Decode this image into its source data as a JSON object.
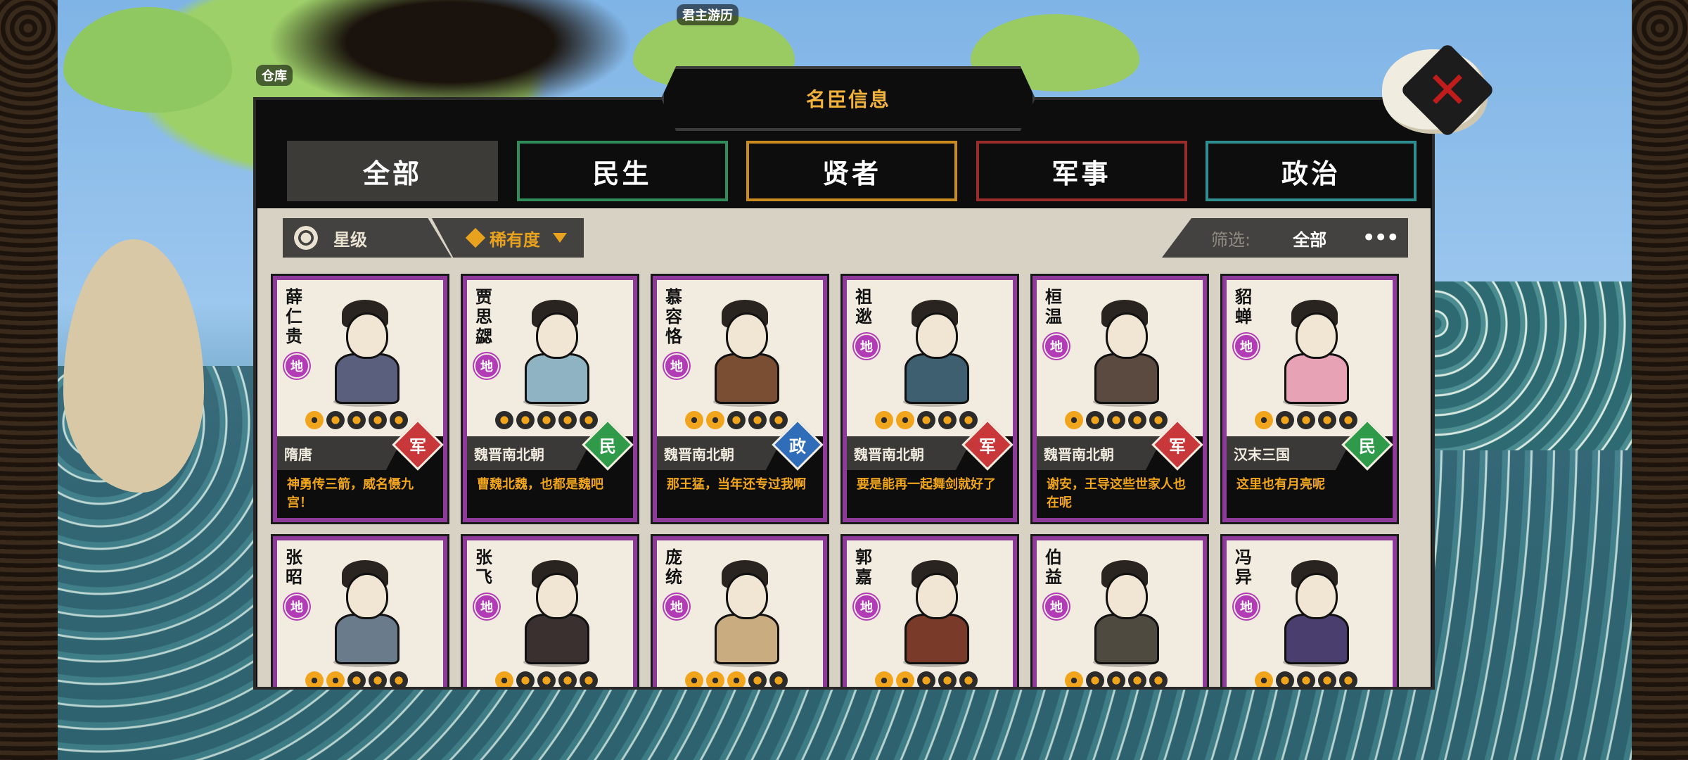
{
  "map": {
    "labels": [
      "君主游历",
      "仓库"
    ]
  },
  "panel": {
    "title": "名臣信息",
    "tabs": [
      {
        "label": "全部",
        "active": true
      },
      {
        "label": "民生",
        "active": false
      },
      {
        "label": "贤者",
        "active": false
      },
      {
        "label": "军事",
        "active": false
      },
      {
        "label": "政治",
        "active": false
      }
    ],
    "sort": {
      "star_label": "星级",
      "rarity_label": "稀有度"
    },
    "filter": {
      "label": "筛选:",
      "value": "全部"
    },
    "close_icon": "close-x-icon"
  },
  "cards": [
    {
      "name": "薛仁贵",
      "grade": "地",
      "stars": 1,
      "era": "隋唐",
      "role": "军",
      "role_color": "#c8373a",
      "quote": "神勇传三箭，威名慑九宫！"
    },
    {
      "name": "贾思勰",
      "grade": "地",
      "stars": 0,
      "era": "魏晋南北朝",
      "role": "民",
      "role_color": "#2f9a4a",
      "quote": "曹魏北魏，也都是魏吧"
    },
    {
      "name": "慕容恪",
      "grade": "地",
      "stars": 2,
      "era": "魏晋南北朝",
      "role": "政",
      "role_color": "#2f6db8",
      "quote": "那王猛，当年还专过我啊"
    },
    {
      "name": "祖逖",
      "grade": "地",
      "stars": 2,
      "era": "魏晋南北朝",
      "role": "军",
      "role_color": "#c8373a",
      "quote": "要是能再一起舞剑就好了"
    },
    {
      "name": "桓温",
      "grade": "地",
      "stars": 1,
      "era": "魏晋南北朝",
      "role": "军",
      "role_color": "#c8373a",
      "quote": "谢安，王导这些世家人也在呢"
    },
    {
      "name": "貂蝉",
      "grade": "地",
      "stars": 1,
      "era": "汉末三国",
      "role": "民",
      "role_color": "#2f9a4a",
      "quote": "这里也有月亮呢"
    },
    {
      "name": "张昭",
      "grade": "地",
      "stars": 2,
      "era": "",
      "role": "",
      "role_color": "",
      "quote": ""
    },
    {
      "name": "张飞",
      "grade": "地",
      "stars": 1,
      "era": "",
      "role": "",
      "role_color": "",
      "quote": ""
    },
    {
      "name": "庞统",
      "grade": "地",
      "stars": 3,
      "era": "",
      "role": "",
      "role_color": "",
      "quote": ""
    },
    {
      "name": "郭嘉",
      "grade": "地",
      "stars": 2,
      "era": "",
      "role": "",
      "role_color": "",
      "quote": ""
    },
    {
      "name": "伯益",
      "grade": "地",
      "stars": 1,
      "era": "",
      "role": "",
      "role_color": "",
      "quote": ""
    },
    {
      "name": "冯异",
      "grade": "地",
      "stars": 1,
      "era": "",
      "role": "",
      "role_color": "",
      "quote": ""
    }
  ]
}
